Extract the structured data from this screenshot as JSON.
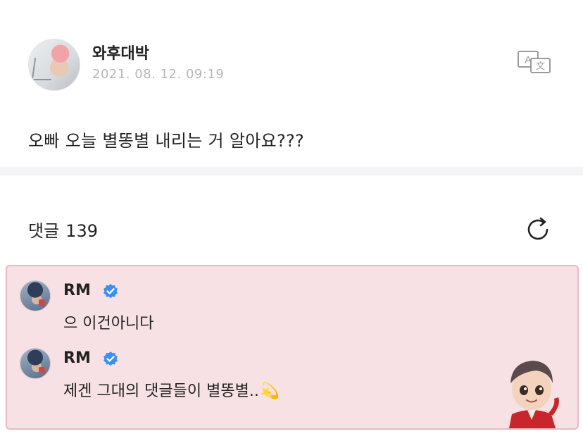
{
  "post": {
    "author": "와후대박",
    "date": "2021. 08. 12. 09:19",
    "body": "오빠 오늘 별똥별 내리는 거 알아요???",
    "translate_icon": "translate-icon",
    "avatar_icon": "avatar"
  },
  "comments_section": {
    "label": "댓글",
    "count": "139",
    "refresh_icon": "refresh-icon"
  },
  "replies": [
    {
      "name": "RM",
      "verified": true,
      "text": "으 이건아니다"
    },
    {
      "name": "RM",
      "verified": true,
      "text": "제겐 그대의 댓글들이 별똥별..",
      "emoji": "💫"
    }
  ],
  "colors": {
    "highlight_bg": "#f7e1e5",
    "highlight_border": "#e8b9c4",
    "verified_blue": "#3b8ff0",
    "date_gray": "#b7b7b7"
  }
}
